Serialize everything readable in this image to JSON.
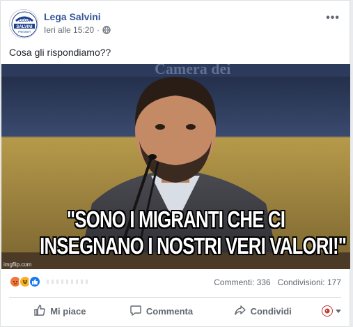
{
  "post": {
    "page_name": "Lega Salvini",
    "timestamp": "Ieri alle 15:20",
    "separator": "·",
    "text": "Cosa gli rispondiamo??",
    "more_label": "•••",
    "avatar": {
      "line1": "LEGA",
      "line2": "SALVINI",
      "line3": "PREMIER"
    }
  },
  "image": {
    "caption_line1": "\"SONO I MIGRANTI CHE CI",
    "caption_line2": "INSEGNANO I NOSTRI VERI VALORI!\"",
    "watermark": "imgflip.com"
  },
  "stats": {
    "comments": "Commenti: 336",
    "shares": "Condivisioni: 177"
  },
  "actions": {
    "like": "Mi piace",
    "comment": "Commenta",
    "share": "Condividi"
  },
  "colors": {
    "link": "#365899",
    "meta": "#606770",
    "like_blue": "#1877f2",
    "angry": "#f0763a",
    "haha": "#f7b125"
  },
  "icons": {
    "globe": "globe-icon",
    "like": "thumbs-up-icon",
    "comment": "comment-bubble-icon",
    "share": "share-arrow-icon"
  }
}
